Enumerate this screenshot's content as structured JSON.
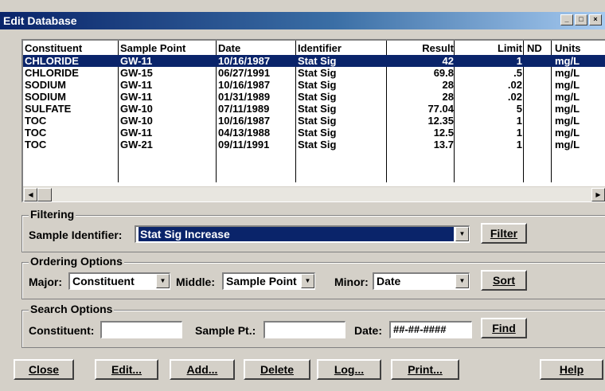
{
  "window": {
    "title": "Edit Database"
  },
  "grid": {
    "columns": [
      "Constituent",
      "Sample Point",
      "Date",
      "Identifier",
      "Result",
      "Limit",
      "ND",
      "Units"
    ],
    "rows": [
      {
        "constituent": "CHLORIDE",
        "sample_point": "GW-11",
        "date": "10/16/1987",
        "identifier": "Stat Sig",
        "result": "42",
        "limit": "1",
        "nd": "",
        "units": "mg/L",
        "selected": true
      },
      {
        "constituent": "CHLORIDE",
        "sample_point": "GW-15",
        "date": "06/27/1991",
        "identifier": "Stat Sig",
        "result": "69.8",
        "limit": ".5",
        "nd": "",
        "units": "mg/L"
      },
      {
        "constituent": "SODIUM",
        "sample_point": "GW-11",
        "date": "10/16/1987",
        "identifier": "Stat Sig",
        "result": "28",
        "limit": ".02",
        "nd": "",
        "units": "mg/L"
      },
      {
        "constituent": "SODIUM",
        "sample_point": "GW-11",
        "date": "01/31/1989",
        "identifier": "Stat Sig",
        "result": "28",
        "limit": ".02",
        "nd": "",
        "units": "mg/L"
      },
      {
        "constituent": "SULFATE",
        "sample_point": "GW-10",
        "date": "07/11/1989",
        "identifier": "Stat Sig",
        "result": "77.04",
        "limit": "5",
        "nd": "",
        "units": "mg/L"
      },
      {
        "constituent": "TOC",
        "sample_point": "GW-10",
        "date": "10/16/1987",
        "identifier": "Stat Sig",
        "result": "12.35",
        "limit": "1",
        "nd": "",
        "units": "mg/L"
      },
      {
        "constituent": "TOC",
        "sample_point": "GW-11",
        "date": "04/13/1988",
        "identifier": "Stat Sig",
        "result": "12.5",
        "limit": "1",
        "nd": "",
        "units": "mg/L"
      },
      {
        "constituent": "TOC",
        "sample_point": "GW-21",
        "date": "09/11/1991",
        "identifier": "Stat Sig",
        "result": "13.7",
        "limit": "1",
        "nd": "",
        "units": "mg/L"
      }
    ]
  },
  "filtering": {
    "title": "Filtering",
    "sample_identifier_label": "Sample Identifier:",
    "sample_identifier_value": "Stat Sig Increase",
    "filter_button": "Filter"
  },
  "ordering": {
    "title": "Ordering Options",
    "major_label": "Major:",
    "major_value": "Constituent",
    "middle_label": "Middle:",
    "middle_value": "Sample Point",
    "minor_label": "Minor:",
    "minor_value": "Date",
    "sort_button": "Sort"
  },
  "search": {
    "title": "Search Options",
    "constituent_label": "Constituent:",
    "constituent_value": "",
    "sample_pt_label": "Sample Pt.:",
    "sample_pt_value": "",
    "date_label": "Date:",
    "date_value": "##-##-####",
    "find_button": "Find"
  },
  "buttons": {
    "close": "Close",
    "edit": "Edit...",
    "add": "Add...",
    "delete": "Delete",
    "log": "Log...",
    "print": "Print...",
    "help": "Help"
  },
  "colors": {
    "selection": "#0a246a",
    "face": "#d4d0c8"
  }
}
